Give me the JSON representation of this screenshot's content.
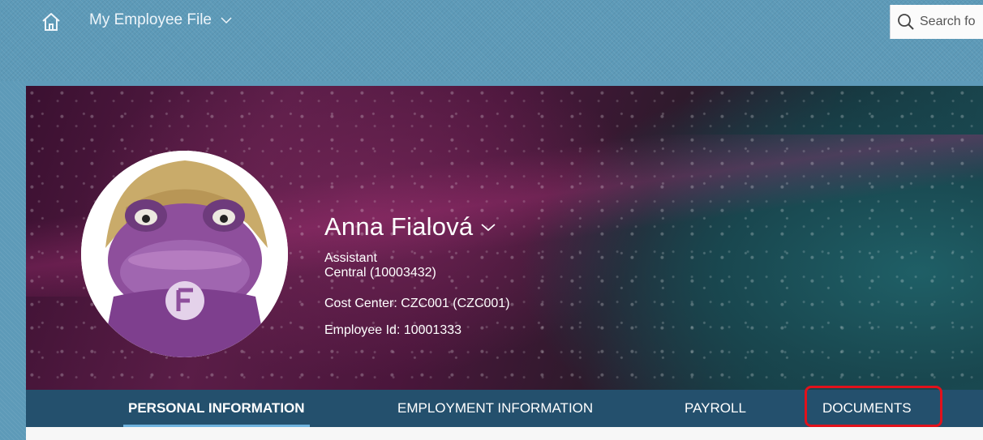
{
  "shell": {
    "app_title": "My Employee File",
    "search_placeholder": "Search fo"
  },
  "employee": {
    "name": "Anna Fialová",
    "job_title": "Assistant",
    "department": "Central (10003432)",
    "cost_center": "Cost Center: CZC001 (CZC001)",
    "employee_id": "Employee Id: 10001333"
  },
  "tabs": [
    {
      "label": "PERSONAL INFORMATION",
      "active": true
    },
    {
      "label": "EMPLOYMENT INFORMATION",
      "active": false
    },
    {
      "label": "PAYROLL",
      "active": false
    },
    {
      "label": "DOCUMENTS",
      "active": false,
      "highlighted": true
    }
  ],
  "icons": {
    "home": "home-icon",
    "app_menu": "chevron-down-icon",
    "search": "search-icon",
    "name_menu": "chevron-down-icon"
  },
  "colors": {
    "shell": "#5d9ab8",
    "tab_bar": "#24506d",
    "highlight": "#e2111b",
    "active_underline": "#6fb2dd"
  }
}
